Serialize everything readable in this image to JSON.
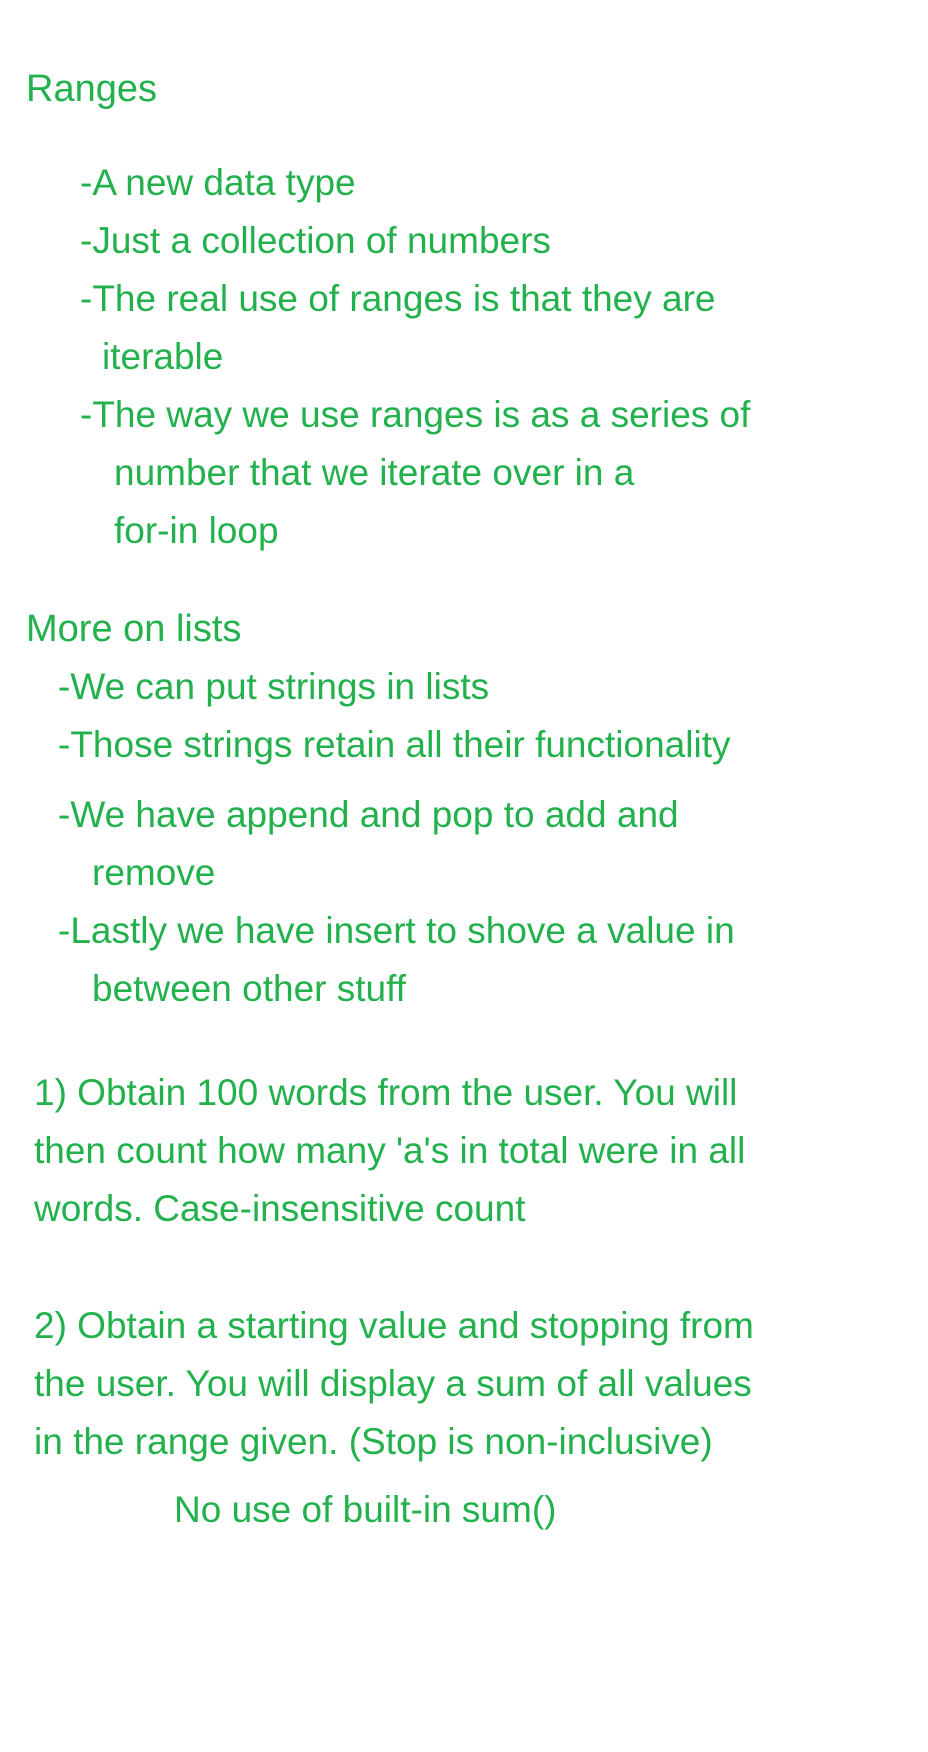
{
  "ranges": {
    "heading": "Ranges",
    "lines": [
      "-A new data type",
      "-Just a collection of numbers",
      "-The real use of ranges is that they are",
      "iterable",
      "-The way we use ranges is as a series of",
      "number that we iterate over in a",
      "for-in loop"
    ]
  },
  "lists": {
    "heading": "More on lists",
    "lines": [
      "-We can put strings in lists",
      "-Those strings retain all their functionality",
      "-We have append and pop to add and",
      "remove",
      "-Lastly we have insert to shove a value in",
      "between other stuff"
    ]
  },
  "exercises": {
    "ex1": [
      "1) Obtain 100 words from the user. You will",
      "then count how many 'a's in total were in all",
      "words. Case-insensitive count"
    ],
    "ex2": [
      "2) Obtain a starting value and stopping from",
      "the user. You will display a sum of all values",
      "in the range given. (Stop is non-inclusive)"
    ],
    "note": "No use of built-in sum()"
  },
  "colors": {
    "text": "#22b14c",
    "background": "#ffffff"
  }
}
